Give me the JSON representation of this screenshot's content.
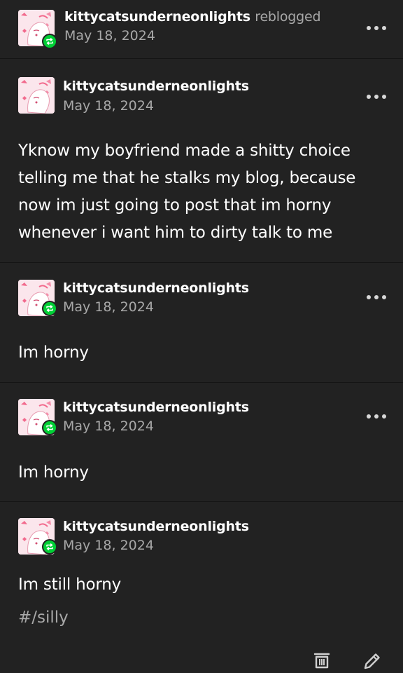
{
  "header": {
    "username": "kittycatsunderneonlights",
    "action": "reblogged",
    "date": "May 18, 2024"
  },
  "posts": [
    {
      "username": "kittycatsunderneonlights",
      "date": "May 18, 2024",
      "text": "Yknow my boyfriend made a shitty choice telling me that he stalks my blog, because now im just going to post that im horny whenever i want him to dirty talk to me"
    },
    {
      "username": "kittycatsunderneonlights",
      "date": "May 18, 2024",
      "text": "Im horny"
    },
    {
      "username": "kittycatsunderneonlights",
      "date": "May 18, 2024",
      "text": "Im horny"
    },
    {
      "username": "kittycatsunderneonlights",
      "date": "May 18, 2024",
      "text": "Im still horny",
      "tag": "#/silly"
    }
  ],
  "icons": {
    "reblog_badge": "reblog-icon",
    "more": "more-options-icon",
    "delete": "trash-icon",
    "edit": "pencil-icon"
  },
  "colors": {
    "background": "#222222",
    "text": "#ffffff",
    "secondary_text": "#a8a8a8",
    "reblog_green": "#00cf35",
    "avatar_pink": "#fbe6ec"
  }
}
